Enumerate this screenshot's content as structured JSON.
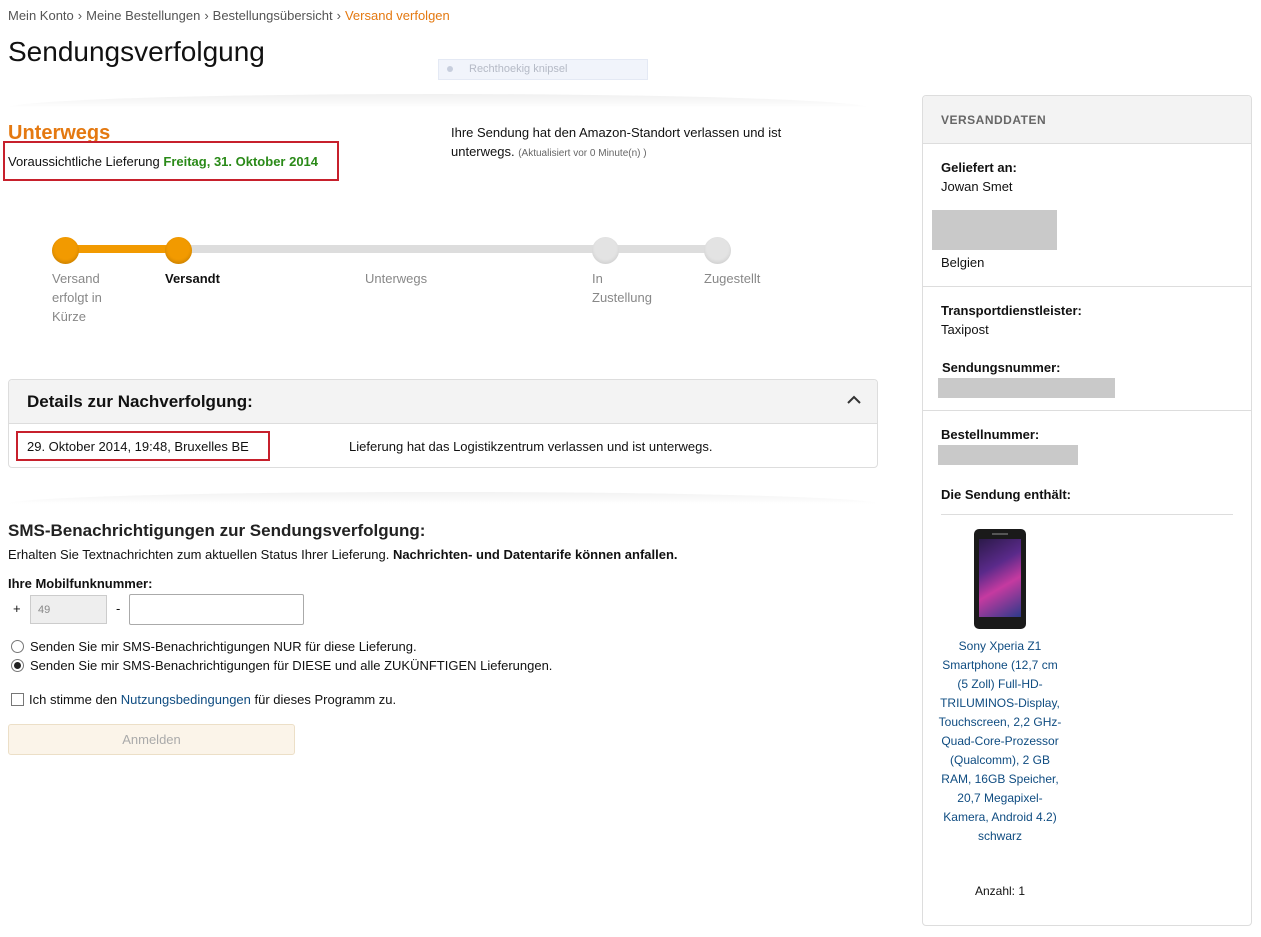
{
  "breadcrumb": {
    "items": [
      "Mein Konto",
      "Meine Bestellungen",
      "Bestellungsübersicht"
    ],
    "current": "Versand verfolgen",
    "separator": "›"
  },
  "page_title": "Sendungsverfolgung",
  "overlay": {
    "snip_label": "Rechthoekig knipsel"
  },
  "status": {
    "title": "Unterwegs",
    "delivery_prefix": "Voraussichtliche Lieferung",
    "delivery_date": "Freitag, 31. Oktober 2014",
    "message": "Ihre Sendung hat den Amazon-Standort verlassen und ist unterwegs.",
    "updated": "(Aktualisiert vor 0 Minute(n) )"
  },
  "progress": {
    "steps": [
      {
        "label": "Versand erfolgt in Kürze",
        "state": "done"
      },
      {
        "label": "Versandt",
        "state": "current"
      },
      {
        "label": "Unterwegs",
        "state": "todo"
      },
      {
        "label": "In Zustellung",
        "state": "todo"
      },
      {
        "label": "Zugestellt",
        "state": "todo"
      }
    ],
    "colors": {
      "done": "#f29a00",
      "todo": "#dddddd"
    }
  },
  "details": {
    "header": "Details zur Nachverfolgung:",
    "rows": [
      {
        "when": "29. Oktober 2014, 19:48, Bruxelles BE",
        "what": "Lieferung hat das Logistikzentrum verlassen und ist unterwegs."
      }
    ]
  },
  "sms": {
    "title": "SMS-Benachrichtigungen zur Sendungsverfolgung:",
    "desc": "Erhalten Sie Textnachrichten zum aktuellen Status Ihrer Lieferung.",
    "desc_bold": "Nachrichten- und Datentarife können anfallen.",
    "phone_label": "Ihre Mobilfunknummer:",
    "plus": "+",
    "country_code": "49",
    "dash": "-",
    "phone_value": "",
    "option_once": "Senden Sie mir SMS-Benachrichtigungen NUR für diese Lieferung.",
    "option_all": "Senden Sie mir SMS-Benachrichtigungen für DIESE und alle ZUKÜNFTIGEN Lieferungen.",
    "selected_option": "all",
    "terms_prefix": "Ich stimme den",
    "terms_link": "Nutzungsbedingungen",
    "terms_suffix": "für dieses Programm zu.",
    "button": "Anmelden"
  },
  "sidebar": {
    "header": "VERSANDDATEN",
    "delivered_to_label": "Geliefert an:",
    "recipient": "Jowan Smet",
    "country": "Belgien",
    "carrier_label": "Transportdienstleister:",
    "carrier": "Taxipost",
    "tracking_label": "Sendungsnummer:",
    "order_label": "Bestellnummer:",
    "contents_label": "Die Sendung enthält:",
    "product_name": "Sony Xperia Z1 Smartphone (12,7 cm (5 Zoll) Full-HD-TRILUMINOS-Display, Touchscreen, 2,2 GHz-Quad-Core-Prozessor (Qualcomm), 2 GB RAM, 16GB Speicher, 20,7 Megapixel-Kamera, Android 4.2) schwarz",
    "quantity": "Anzahl: 1"
  },
  "colors": {
    "accent_orange": "#e47911",
    "delivery_green": "#2a8a18",
    "highlight_red": "#c7202c",
    "link_blue": "#0f4c81"
  }
}
